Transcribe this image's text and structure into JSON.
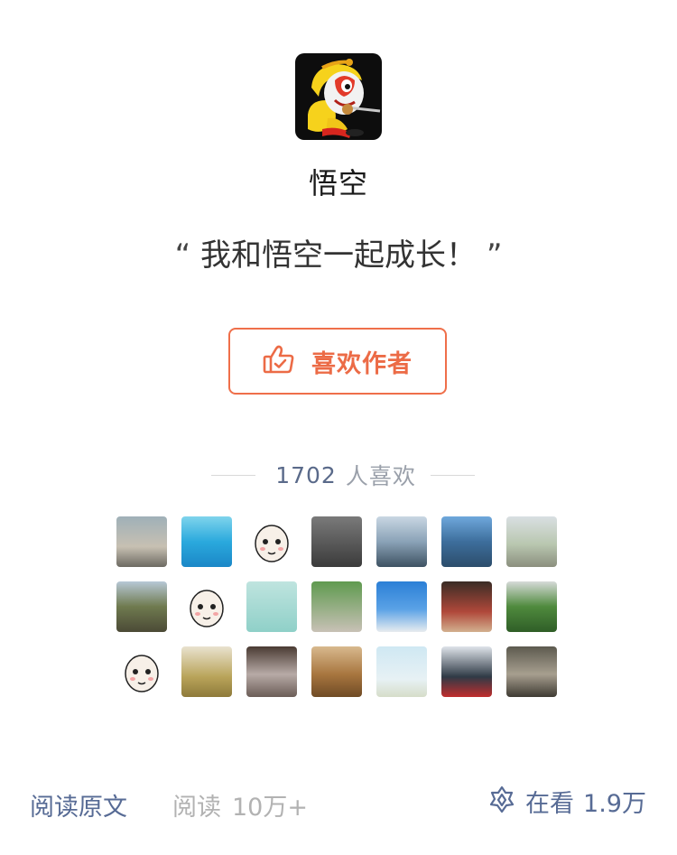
{
  "author": {
    "name": "悟空"
  },
  "quote": {
    "open": "“",
    "text": "我和悟空一起成长！",
    "close": "”"
  },
  "like_button": {
    "label": "喜欢作者",
    "icon": "thumbs-up-icon",
    "color": "#ec6b46"
  },
  "likes": {
    "count": "1702",
    "label": "人喜欢"
  },
  "liker_avatars": [
    {
      "name": "liker-avatar-1",
      "bg": "linear-gradient(#9fb0b8,#c7c0b2 60%,#6d6a62)"
    },
    {
      "name": "liker-avatar-2",
      "bg": "linear-gradient(#7fd4ec,#2aa9dd 50%,#1b87c7)"
    },
    {
      "name": "liker-avatar-3",
      "bg": "#ffffff"
    },
    {
      "name": "liker-avatar-4",
      "bg": "linear-gradient(#7a7a7a,#3b3b3b)"
    },
    {
      "name": "liker-avatar-5",
      "bg": "linear-gradient(#c9d7e3,#8aa2b7 50%,#3e5262)"
    },
    {
      "name": "liker-avatar-6",
      "bg": "linear-gradient(#6fa8dc,#3d6e9c 50%,#2c4d6b)"
    },
    {
      "name": "liker-avatar-7",
      "bg": "linear-gradient(#d9dfe2,#b9c7b0 55%,#8b8f7e)"
    },
    {
      "name": "liker-avatar-8",
      "bg": "linear-gradient(#b7c8d6,#6f7a4f 50%,#4b4a36)"
    },
    {
      "name": "liker-avatar-9",
      "bg": "#ffffff"
    },
    {
      "name": "liker-avatar-10",
      "bg": "linear-gradient(#bfe4df,#8fd0c8)"
    },
    {
      "name": "liker-avatar-11",
      "bg": "linear-gradient(#5f9a4f,#c8c1b6)"
    },
    {
      "name": "liker-avatar-12",
      "bg": "linear-gradient(#2b7fd6,#5aa2e6 55%,#e8ecef)"
    },
    {
      "name": "liker-avatar-13",
      "bg": "linear-gradient(#3a2c25,#b0483a 60%,#d2b08f)"
    },
    {
      "name": "liker-avatar-14",
      "bg": "linear-gradient(#d6dad8,#4f8a3d 50%,#2f5e27)"
    },
    {
      "name": "liker-avatar-15",
      "bg": "#ffffff"
    },
    {
      "name": "liker-avatar-16",
      "bg": "linear-gradient(#e9e2cf,#b9a45a 60%,#8e7a3a)"
    },
    {
      "name": "liker-avatar-17",
      "bg": "linear-gradient(#4a3b33,#b7aaa6 55%,#6b5d57)"
    },
    {
      "name": "liker-avatar-18",
      "bg": "linear-gradient(#d8b98e,#a8763f 55%,#6f4b25)"
    },
    {
      "name": "liker-avatar-19",
      "bg": "linear-gradient(#cfe8f3,#e7f1f4 65%,#d6ddc9)"
    },
    {
      "name": "liker-avatar-20",
      "bg": "linear-gradient(#dfe4ea,#2f3a46 60%,#c12d2d)"
    },
    {
      "name": "liker-avatar-21",
      "bg": "linear-gradient(#5d5a4f,#a79f8f 55%,#3f3b33)"
    }
  ],
  "footer": {
    "read_original": "阅读原文",
    "reads_label": "阅读",
    "reads_count": "10万+",
    "viewing_label": "在看",
    "viewing_count": "1.9万",
    "accent": "#576b95",
    "muted": "#b2b2b2"
  }
}
